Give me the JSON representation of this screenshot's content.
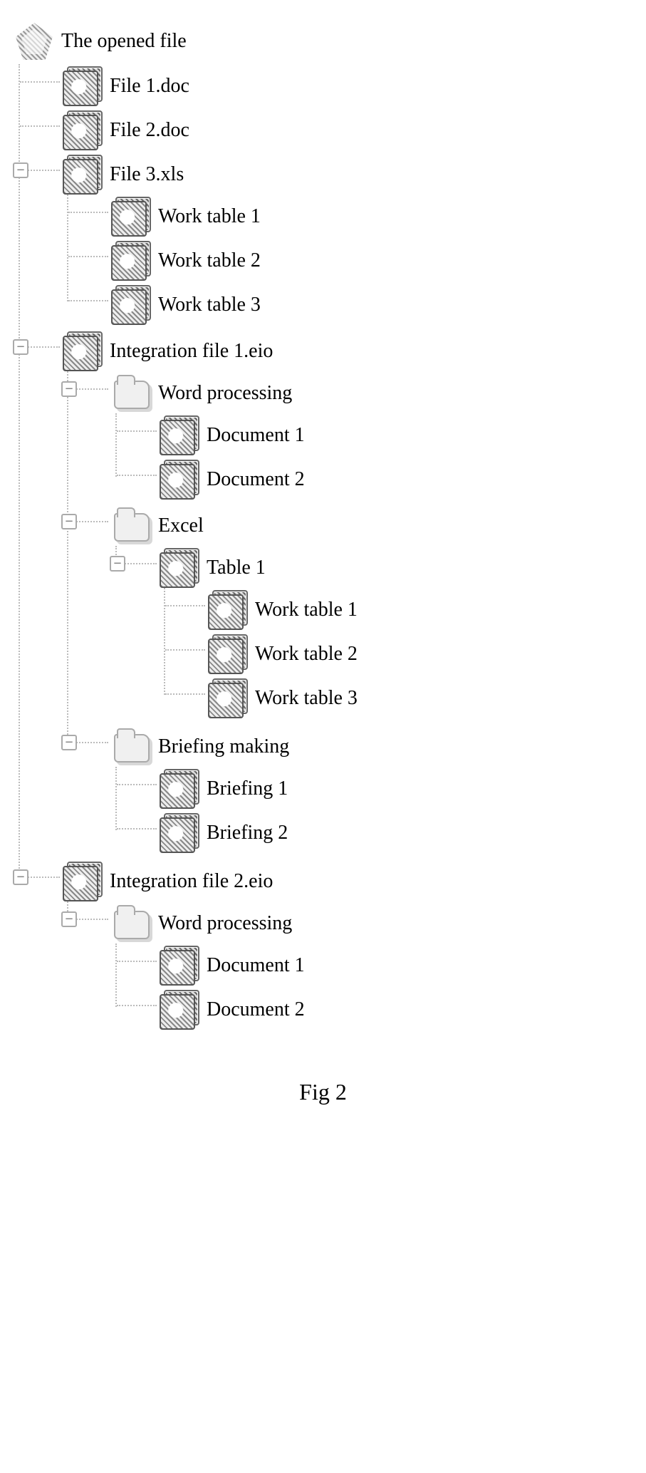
{
  "caption": "Fig 2",
  "root": {
    "label": "The opened file",
    "icon": "poly"
  },
  "tree": [
    {
      "label": "File 1.doc",
      "icon": "box",
      "expander": null,
      "children": null
    },
    {
      "label": "File 2.doc",
      "icon": "box",
      "expander": null,
      "children": null
    },
    {
      "label": "File 3.xls",
      "icon": "box",
      "expander": "−",
      "children": [
        {
          "label": "Work table 1",
          "icon": "box",
          "expander": null,
          "children": null
        },
        {
          "label": "Work table 2",
          "icon": "box",
          "expander": null,
          "children": null
        },
        {
          "label": "Work table 3",
          "icon": "box",
          "expander": null,
          "children": null
        }
      ]
    },
    {
      "label": "Integration file 1.eio",
      "icon": "box",
      "expander": "−",
      "children": [
        {
          "label": "Word processing",
          "icon": "folder",
          "expander": "−",
          "children": [
            {
              "label": "Document 1",
              "icon": "box",
              "expander": null,
              "children": null
            },
            {
              "label": "Document 2",
              "icon": "box",
              "expander": null,
              "children": null
            }
          ]
        },
        {
          "label": "Excel",
          "icon": "folder",
          "expander": "−",
          "children": [
            {
              "label": "Table 1",
              "icon": "box",
              "expander": "−",
              "children": [
                {
                  "label": "Work table 1",
                  "icon": "box",
                  "expander": null,
                  "children": null
                },
                {
                  "label": "Work table 2",
                  "icon": "box",
                  "expander": null,
                  "children": null
                },
                {
                  "label": "Work table 3",
                  "icon": "box",
                  "expander": null,
                  "children": null
                }
              ]
            }
          ]
        },
        {
          "label": "Briefing  making",
          "icon": "folder",
          "expander": "−",
          "children": [
            {
              "label": "Briefing 1",
              "icon": "box",
              "expander": null,
              "children": null
            },
            {
              "label": "Briefing  2",
              "icon": "box",
              "expander": null,
              "children": null
            }
          ]
        }
      ]
    },
    {
      "label": "Integration file 2.eio",
      "icon": "box",
      "expander": "−",
      "children": [
        {
          "label": "Word processing",
          "icon": "folder",
          "expander": "−",
          "children": [
            {
              "label": "Document 1",
              "icon": "box",
              "expander": null,
              "children": null
            },
            {
              "label": "Document 2",
              "icon": "box",
              "expander": null,
              "children": null
            }
          ]
        }
      ]
    }
  ]
}
